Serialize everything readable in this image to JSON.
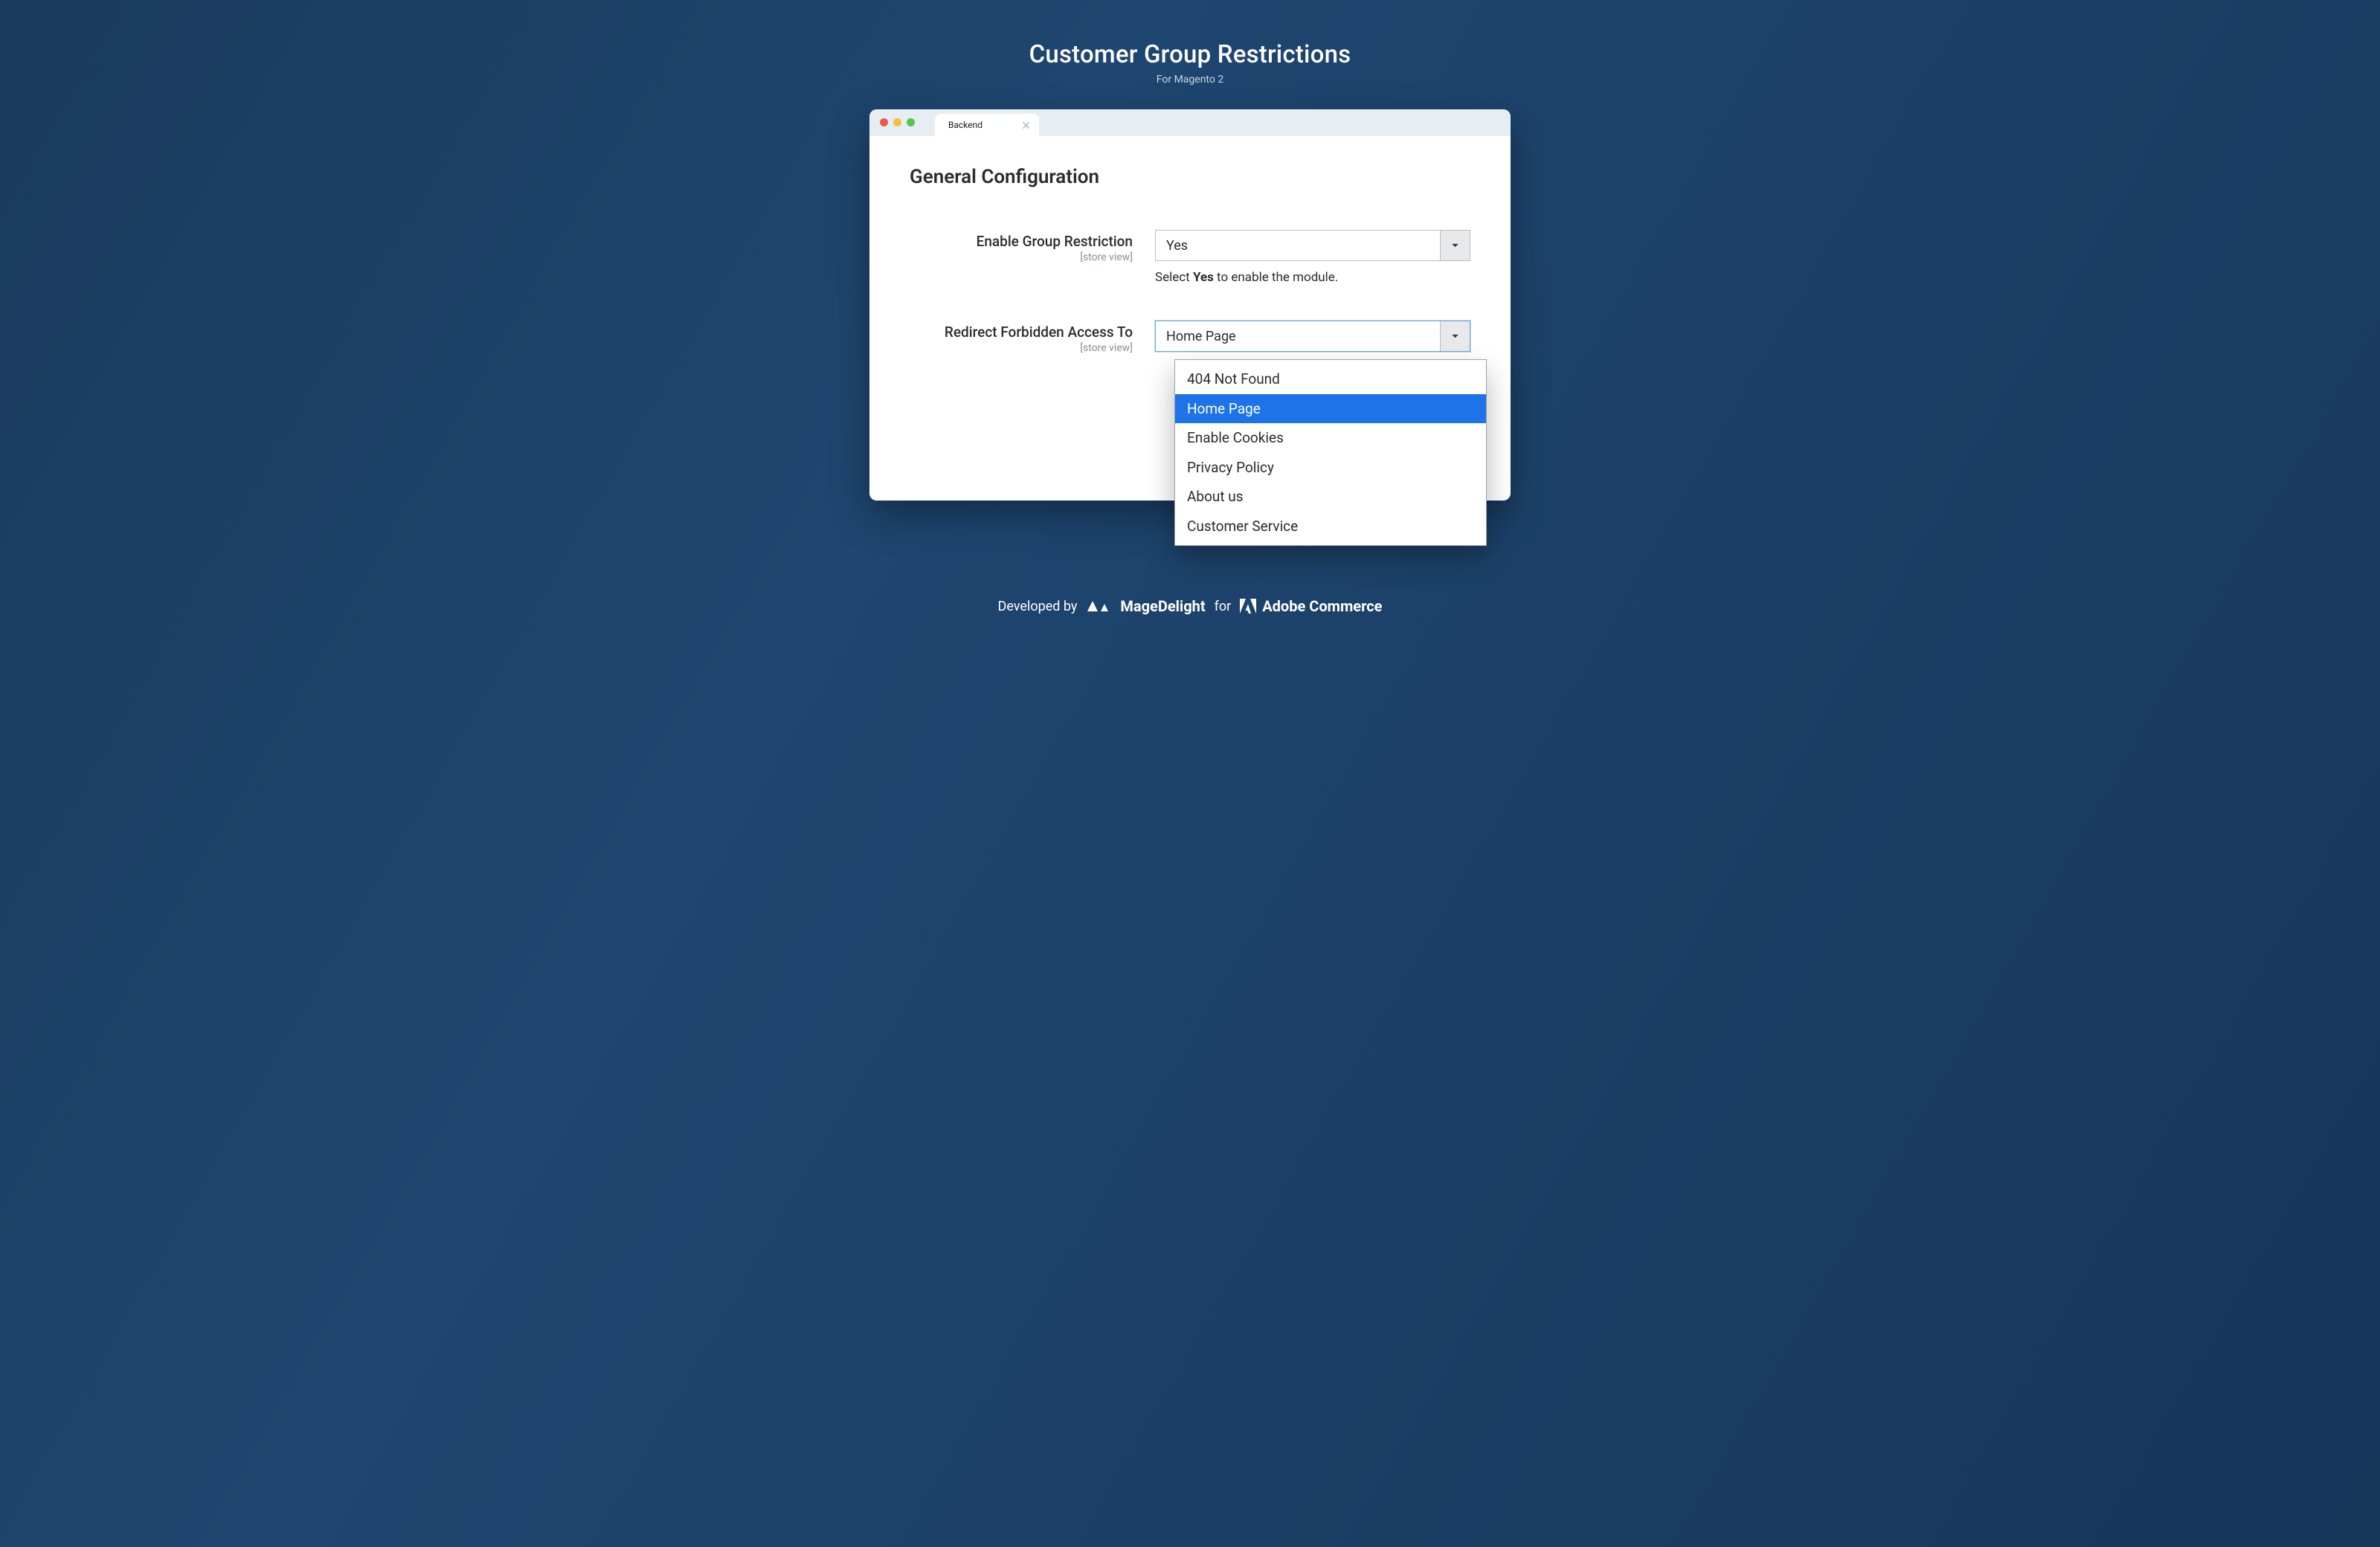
{
  "header": {
    "title": "Customer Group Restrictions",
    "subtitle": "For Magento 2"
  },
  "window": {
    "tab_label": "Backend"
  },
  "section": {
    "heading": "General Configuration"
  },
  "fields": {
    "enable": {
      "label": "Enable Group Restriction",
      "scope": "[store view]",
      "value": "Yes",
      "help_pre": "Select ",
      "help_bold": "Yes",
      "help_post": " to enable the module."
    },
    "redirect": {
      "label": "Redirect Forbidden Access To",
      "scope": "[store view]",
      "value": "Home Page",
      "options": [
        "404 Not Found",
        "Home Page",
        "Enable Cookies",
        "Privacy Policy",
        "About us",
        "Customer Service"
      ],
      "selected_index": 1
    }
  },
  "footer": {
    "developed_by": "Developed by",
    "brand_md": "MageDelight",
    "for": "for",
    "brand_adobe": "Adobe Commerce"
  }
}
